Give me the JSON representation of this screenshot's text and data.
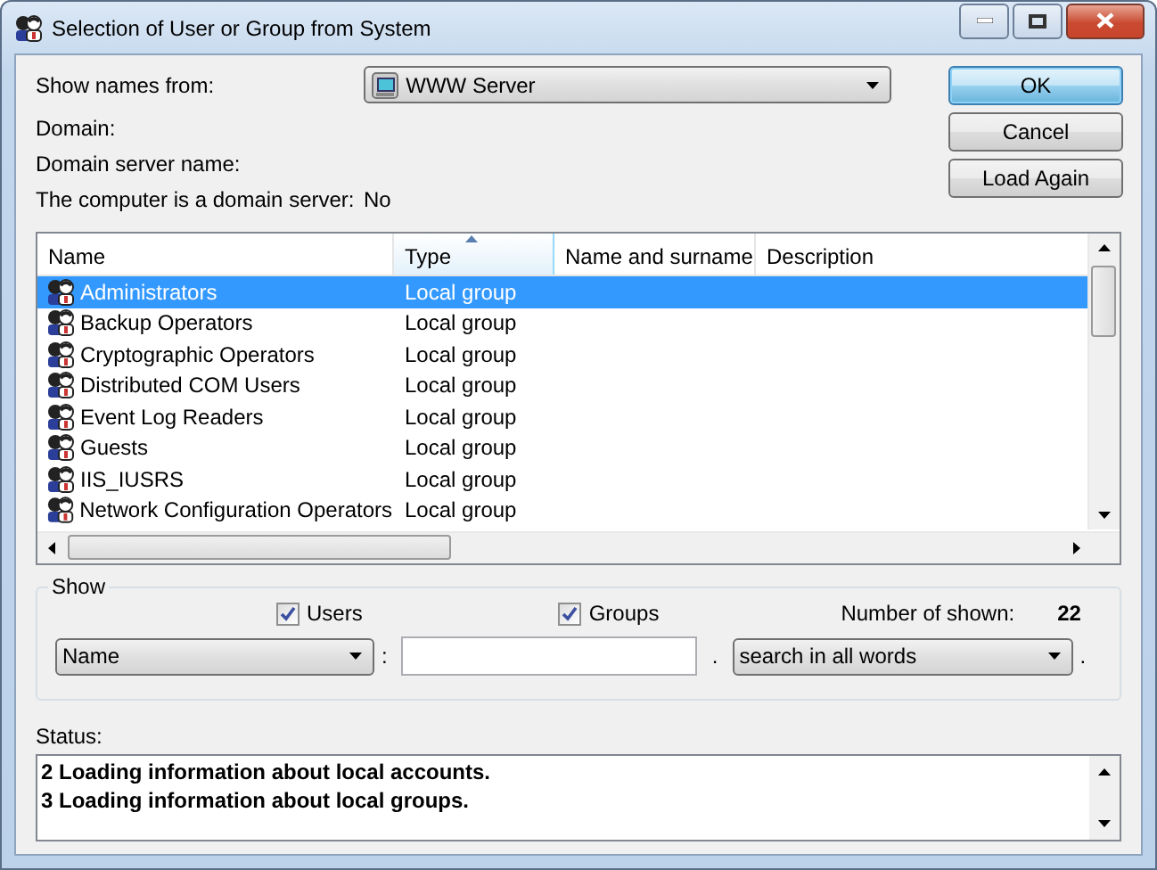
{
  "window": {
    "title": "Selection of User or Group from System"
  },
  "source": {
    "label": "Show names from:",
    "value": "WWW Server"
  },
  "info": [
    {
      "label": "Domain:"
    },
    {
      "label": "Domain server name:"
    },
    {
      "label": "The computer is a domain server:",
      "value": "No"
    }
  ],
  "buttons": [
    {
      "label": "OK",
      "default": true
    },
    {
      "label": "Cancel",
      "default": false
    },
    {
      "label": "Load Again",
      "default": false
    }
  ],
  "list": {
    "columns": [
      {
        "label": "Name",
        "sorted": false
      },
      {
        "label": "Type",
        "sorted": true
      },
      {
        "label": "Name and surname",
        "sorted": false
      },
      {
        "label": "Description",
        "sorted": false
      }
    ],
    "rows": [
      {
        "name": "Administrators",
        "type": "Local group",
        "selected": true
      },
      {
        "name": "Backup Operators",
        "type": "Local group",
        "selected": false
      },
      {
        "name": "Cryptographic Operators",
        "type": "Local group",
        "selected": false
      },
      {
        "name": "Distributed COM Users",
        "type": "Local group",
        "selected": false
      },
      {
        "name": "Event Log Readers",
        "type": "Local group",
        "selected": false
      },
      {
        "name": "Guests",
        "type": "Local group",
        "selected": false
      },
      {
        "name": "IIS_IUSRS",
        "type": "Local group",
        "selected": false
      },
      {
        "name": "Network Configuration Operators",
        "type": "Local group",
        "selected": false
      }
    ]
  },
  "show": {
    "title": "Show",
    "checks": [
      {
        "label": "Users",
        "checked": true
      },
      {
        "label": "Groups",
        "checked": true
      }
    ],
    "count_label": "Number of shown:",
    "count": "22",
    "field": {
      "value": "Name"
    },
    "colon": ":",
    "dot": ".",
    "mode": {
      "value": "search in all words"
    },
    "end_dot": "."
  },
  "status": {
    "label": "Status:",
    "lines": [
      "2 Loading information about local accounts.",
      "3 Loading information about local groups."
    ]
  }
}
